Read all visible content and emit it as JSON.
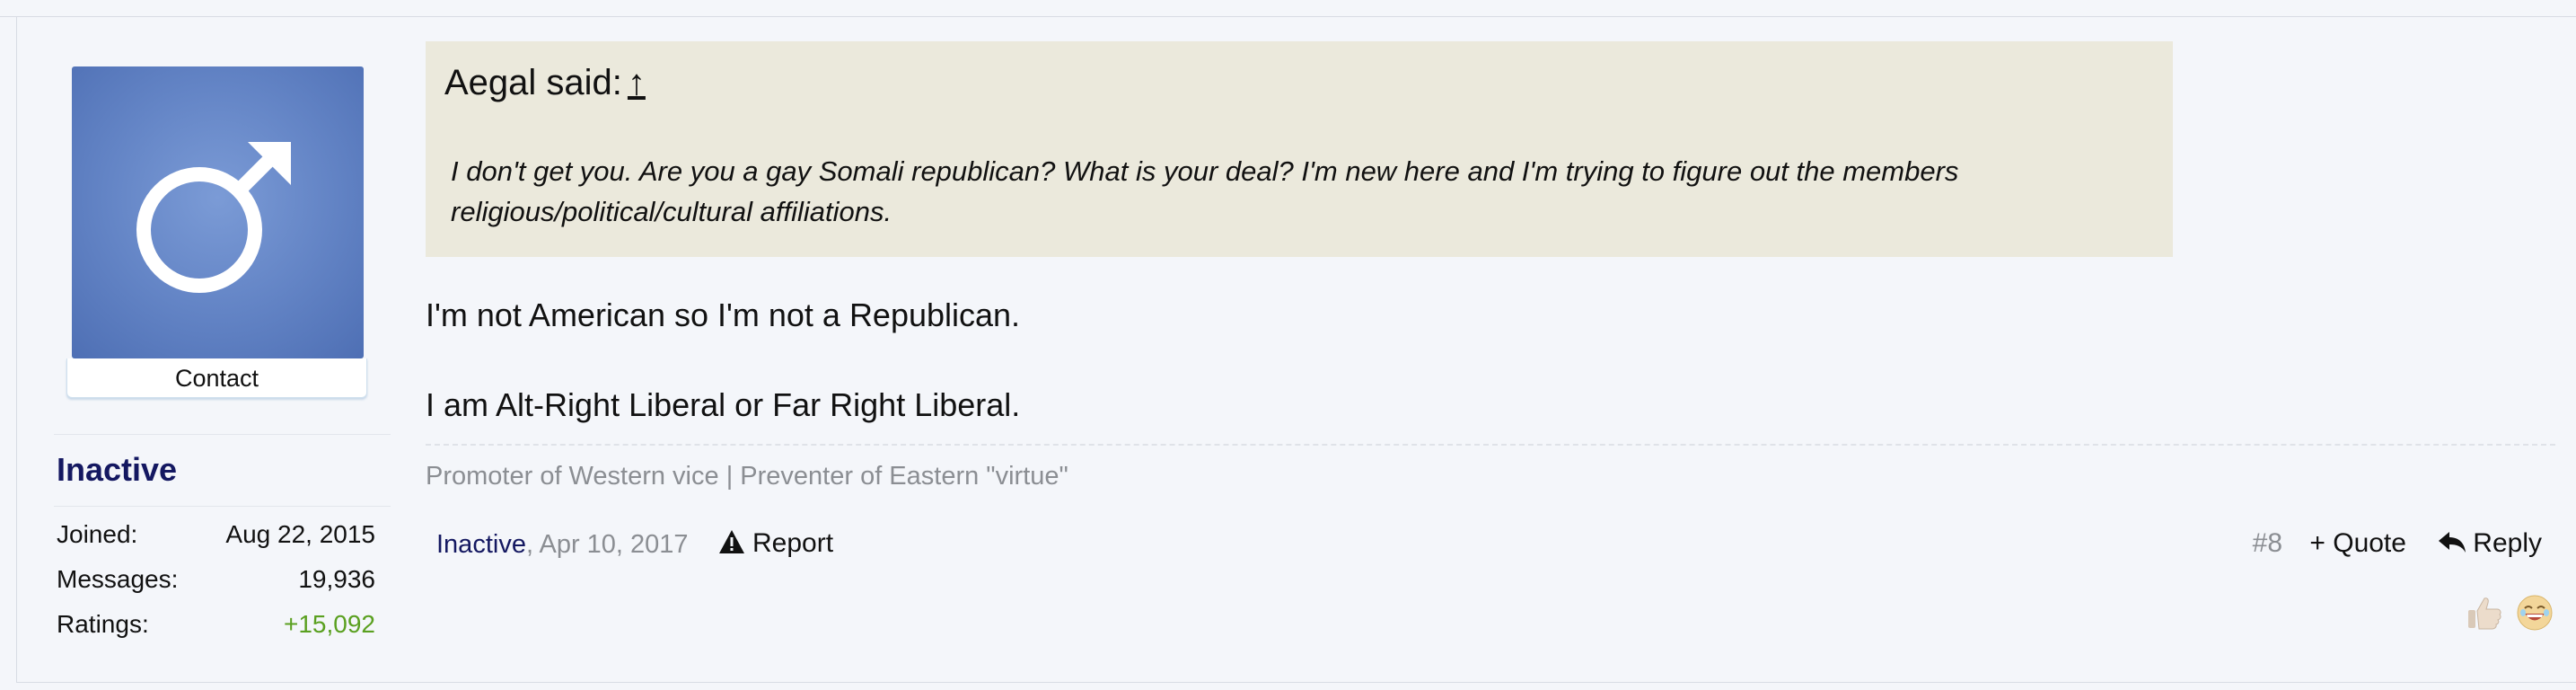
{
  "user": {
    "avatar_icon": "male-symbol-icon",
    "contact_label": "Contact",
    "name": "Inactive",
    "stats": [
      {
        "label": "Joined:",
        "value": "Aug 22, 2015"
      },
      {
        "label": "Messages:",
        "value": "19,936"
      },
      {
        "label": "Ratings:",
        "value": "+15,092"
      }
    ]
  },
  "quote": {
    "author_said": "Aegal said:",
    "jump_arrow": "↑",
    "text": "I don't get you. Are you a gay Somali republican? What is your deal? I'm new here and I'm trying to figure out the members religious/political/cultural affiliations."
  },
  "message": {
    "lines": [
      "I'm not American so I'm not a Republican.",
      "I am Alt-Right Liberal or Far Right Liberal."
    ]
  },
  "signature": "Promoter of Western vice | Preventer of Eastern \"virtue\"",
  "footer": {
    "author": "Inactive",
    "separator": ",",
    "date": "Apr 10, 2017",
    "report_label": "Report",
    "post_number": "#8",
    "quote_label": "+ Quote",
    "reply_label": "Reply"
  },
  "ratings_icons": [
    "thumbs-up-icon",
    "laughing-face-icon"
  ],
  "colors": {
    "username": "#141861",
    "ratings_positive": "#5aa020",
    "quote_background": "#ebe9dc",
    "avatar_blue": "#6485c6",
    "muted_text": "#8b8e93"
  }
}
